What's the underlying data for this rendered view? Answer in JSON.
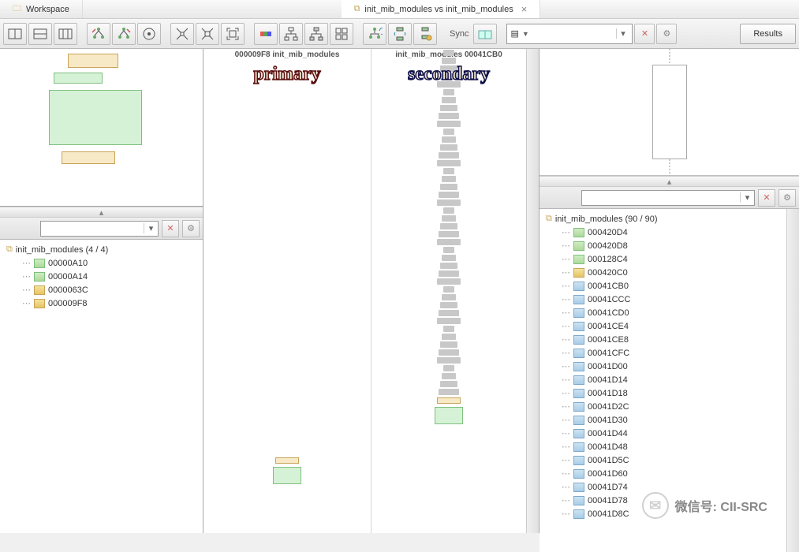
{
  "tabs": {
    "workspace": "Workspace",
    "diff": "init_mib_modules vs init_mib_modules"
  },
  "toolbar": {
    "sync_label": "Sync",
    "results_label": "Results"
  },
  "left_tree": {
    "root": "init_mib_modules (4 / 4)",
    "items": [
      {
        "addr": "00000A10",
        "kind": "green"
      },
      {
        "addr": "00000A14",
        "kind": "green"
      },
      {
        "addr": "0000063C",
        "kind": "yellow"
      },
      {
        "addr": "000009F8",
        "kind": "yellow"
      }
    ]
  },
  "diff": {
    "primary_header": "000009F8 init_mib_modules",
    "primary_label": "primary",
    "secondary_header": "init_mib_modules 00041CB0",
    "secondary_label": "secondary"
  },
  "right_tree": {
    "root": "init_mib_modules (90 / 90)",
    "items": [
      {
        "addr": "000420D4",
        "kind": "green"
      },
      {
        "addr": "000420D8",
        "kind": "green"
      },
      {
        "addr": "000128C4",
        "kind": "green"
      },
      {
        "addr": "000420C0",
        "kind": "yellow"
      },
      {
        "addr": "00041CB0",
        "kind": "blue"
      },
      {
        "addr": "00041CCC",
        "kind": "blue"
      },
      {
        "addr": "00041CD0",
        "kind": "blue"
      },
      {
        "addr": "00041CE4",
        "kind": "blue"
      },
      {
        "addr": "00041CE8",
        "kind": "blue"
      },
      {
        "addr": "00041CFC",
        "kind": "blue"
      },
      {
        "addr": "00041D00",
        "kind": "blue"
      },
      {
        "addr": "00041D14",
        "kind": "blue"
      },
      {
        "addr": "00041D18",
        "kind": "blue"
      },
      {
        "addr": "00041D2C",
        "kind": "blue"
      },
      {
        "addr": "00041D30",
        "kind": "blue"
      },
      {
        "addr": "00041D44",
        "kind": "blue"
      },
      {
        "addr": "00041D48",
        "kind": "blue"
      },
      {
        "addr": "00041D5C",
        "kind": "blue"
      },
      {
        "addr": "00041D60",
        "kind": "blue"
      },
      {
        "addr": "00041D74",
        "kind": "blue"
      },
      {
        "addr": "00041D78",
        "kind": "blue"
      },
      {
        "addr": "00041D8C",
        "kind": "blue"
      }
    ]
  },
  "watermark": "微信号: CII-SRC"
}
